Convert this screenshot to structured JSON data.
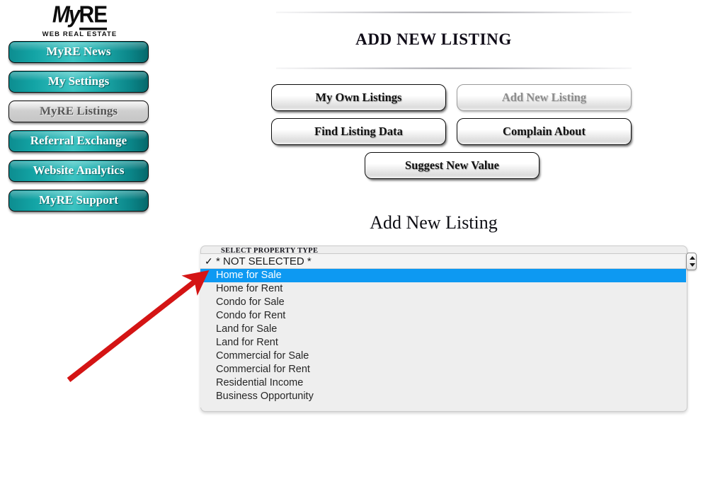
{
  "brand": {
    "mark_my": "My",
    "mark_re": "RE",
    "tagline": "WEB REAL ESTATE"
  },
  "sidebar": {
    "items": [
      {
        "label": "MyRE News",
        "state": "normal"
      },
      {
        "label": "My Settings",
        "state": "normal"
      },
      {
        "label": "MyRE Listings",
        "state": "active"
      },
      {
        "label": "Referral Exchange",
        "state": "normal"
      },
      {
        "label": "Website Analytics",
        "state": "normal"
      },
      {
        "label": "MyRE Support",
        "state": "normal"
      }
    ]
  },
  "header": {
    "title": "ADD NEW LISTING"
  },
  "toolbar": {
    "my_own_listings": "My Own Listings",
    "add_new_listing": "Add New Listing",
    "find_listing_data": "Find Listing Data",
    "complain_about": "Complain About",
    "suggest_new_value": "Suggest New Value"
  },
  "section": {
    "title": "Add New Listing"
  },
  "form": {
    "field_label": "SELECT PROPERTY TYPE",
    "selected_value": "* NOT SELECTED *",
    "check_glyph": "✓",
    "options": [
      "Home for Sale",
      "Home for Rent",
      "Condo for Sale",
      "Condo for Rent",
      "Land for Sale",
      "Land for Rent",
      "Commercial for Sale",
      "Commercial for Rent",
      "Residential Income",
      "Business Opportunity"
    ],
    "highlighted_option": "Home for Sale"
  },
  "colors": {
    "nav_teal": "#13a4a5",
    "nav_active_bg": "#cfcfcf",
    "highlight_blue": "#0d99f2",
    "panel_gray": "#eeeeee",
    "annotation_red": "#d41414"
  },
  "icons": {
    "stepper": "up-down-stepper-icon",
    "checkmark": "checkmark-icon",
    "arrow": "annotation-arrow-icon"
  }
}
